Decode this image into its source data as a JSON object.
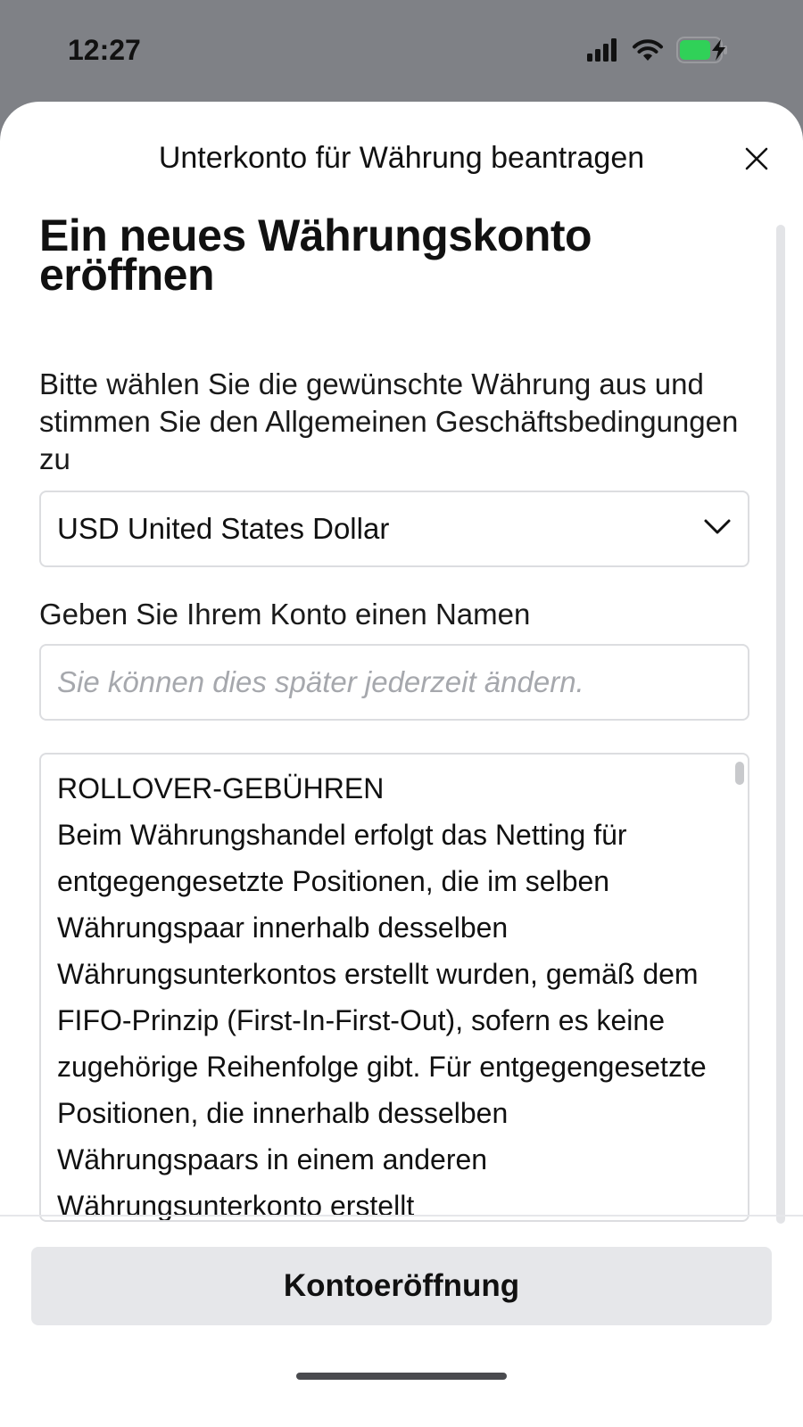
{
  "status_bar": {
    "time": "12:27",
    "battery_color": "#30d158"
  },
  "sheet": {
    "title": "Unterkonto für Währung beantragen"
  },
  "main": {
    "heading": "Ein neues Währungskonto eröffnen",
    "intro": "Bitte wählen Sie die gewünschte Währung aus und stimmen Sie den Allgemeinen Geschäftsbedingungen zu",
    "currency_select": {
      "value": "USD United States Dollar",
      "icon": "chevron-down-icon"
    },
    "name_label": "Geben Sie Ihrem Konto einen Namen",
    "name_input": {
      "value": "",
      "placeholder": "Sie können dies später jederzeit ändern."
    },
    "terms": {
      "title": "ROLLOVER-GEBÜHREN",
      "body": "Beim Währungshandel erfolgt das Netting für entgegengesetzte Positionen, die im selben Währungspaar innerhalb desselben Währungsunterkontos erstellt wurden, gemäß dem FIFO-Prinzip (First-In-First-Out), sofern es keine zugehörige Reihenfolge gibt. Für entgegengesetzte Positionen, die innerhalb desselben Währungspaars in einem anderen Währungsunterkonto erstellt"
    }
  },
  "footer": {
    "open_account_label": "Kontoeröffnung"
  },
  "colors": {
    "backdrop": "#7f8186",
    "button_bg": "#e6e7ea",
    "border": "#dcdde0",
    "placeholder": "#a6a8ad"
  }
}
